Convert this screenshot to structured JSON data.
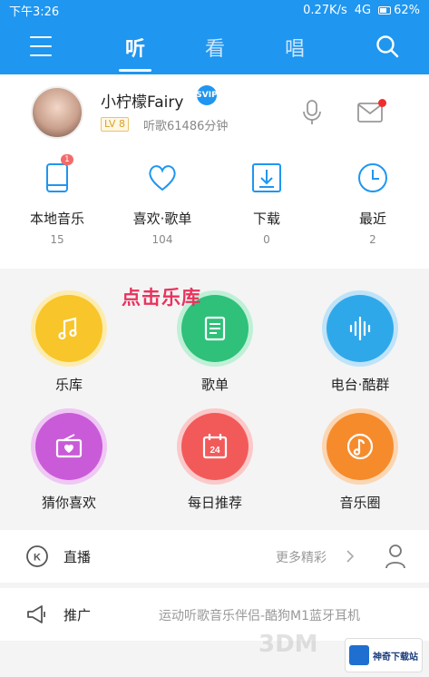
{
  "status_bar": {
    "time": "下午3:26",
    "speed": "0.27K/s",
    "network": "4G",
    "battery": "62%"
  },
  "nav": {
    "tabs": [
      "听",
      "看",
      "唱"
    ],
    "active_tab": "听"
  },
  "profile": {
    "username": "小柠檬Fairy",
    "vip_badge": "SVIP",
    "level": "LV 8",
    "listen_time": "听歌61486分钟"
  },
  "quick_access": [
    {
      "label": "本地音乐",
      "count": "15",
      "badge": "1"
    },
    {
      "label": "喜欢·歌单",
      "count": "104"
    },
    {
      "label": "下载",
      "count": "0"
    },
    {
      "label": "最近",
      "count": "2"
    }
  ],
  "annotation": "点击乐库",
  "grid": [
    {
      "label": "乐库",
      "color": "#f8c52a",
      "icon": "music-note-icon"
    },
    {
      "label": "歌单",
      "color": "#2fc07a",
      "icon": "playlist-icon"
    },
    {
      "label": "电台·酷群",
      "color": "#2fa8ea",
      "icon": "radio-wave-icon"
    },
    {
      "label": "猜你喜欢",
      "color": "#c95bd8",
      "icon": "radio-heart-icon"
    },
    {
      "label": "每日推荐",
      "color": "#f25a5a",
      "icon": "calendar-icon",
      "calendar_day": "24"
    },
    {
      "label": "音乐圈",
      "color": "#f68b2c",
      "icon": "music-circle-icon"
    }
  ],
  "live_row": {
    "title": "直播",
    "more": "更多精彩"
  },
  "promo_row": {
    "title": "推广",
    "text": "运动听歌音乐伴侣-酷狗M1蓝牙耳机"
  },
  "watermark": "3DM",
  "site_badge": "神奇下载站"
}
